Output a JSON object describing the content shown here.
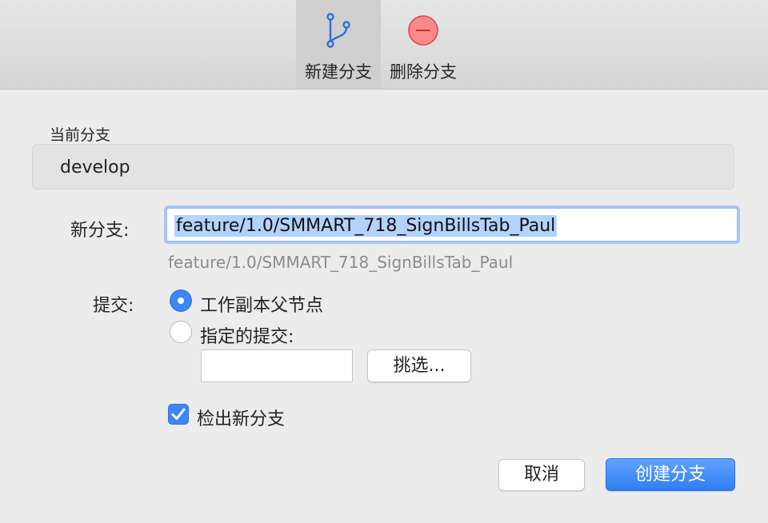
{
  "toolbar": {
    "new_branch": {
      "label": "新建分支",
      "icon": "git-branch-icon"
    },
    "delete_branch": {
      "label": "删除分支",
      "icon": "minus-circle-icon"
    }
  },
  "current_branch": {
    "label": "当前分支",
    "value": "develop"
  },
  "new_branch": {
    "label": "新分支:",
    "value": "feature/1.0/SMMART_718_SignBillsTab_Paul",
    "preview": "feature/1.0/SMMART_718_SignBillsTab_Paul"
  },
  "commit": {
    "label": "提交:",
    "options": [
      {
        "label": "工作副本父节点",
        "selected": true
      },
      {
        "label": "指定的提交:",
        "selected": false
      }
    ],
    "input_value": "",
    "pick_button": "挑选..."
  },
  "checkout": {
    "label": "检出新分支",
    "checked": true
  },
  "actions": {
    "cancel": "取消",
    "create": "创建分支"
  },
  "colors": {
    "accent": "#3d86f5",
    "delete_icon": "#e14b4b"
  }
}
